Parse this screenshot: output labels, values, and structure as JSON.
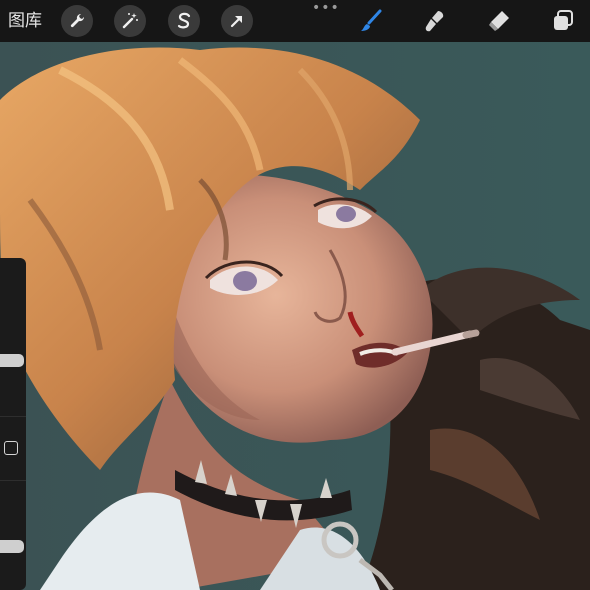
{
  "toolbar": {
    "gallery_label": "图库",
    "tools_left": [
      {
        "icon": "wrench-icon",
        "name": "actions"
      },
      {
        "icon": "magic-wand-icon",
        "name": "adjustments"
      },
      {
        "icon": "selection-s-icon",
        "name": "selection"
      },
      {
        "icon": "arrow-cursor-icon",
        "name": "transform"
      }
    ],
    "more_label": "•••",
    "tools_right": [
      {
        "icon": "brush-icon",
        "name": "paint",
        "active": true
      },
      {
        "icon": "smudge-icon",
        "name": "smudge"
      },
      {
        "icon": "eraser-icon",
        "name": "erase"
      },
      {
        "icon": "layers-icon",
        "name": "layers"
      }
    ]
  },
  "colors": {
    "toolbar_bg": "#161616",
    "accent": "#2f86e6",
    "canvas_bg": "#2f4a4c"
  },
  "sidebar": {
    "brush_size_level": 0.35,
    "opacity_level": 0.75
  }
}
